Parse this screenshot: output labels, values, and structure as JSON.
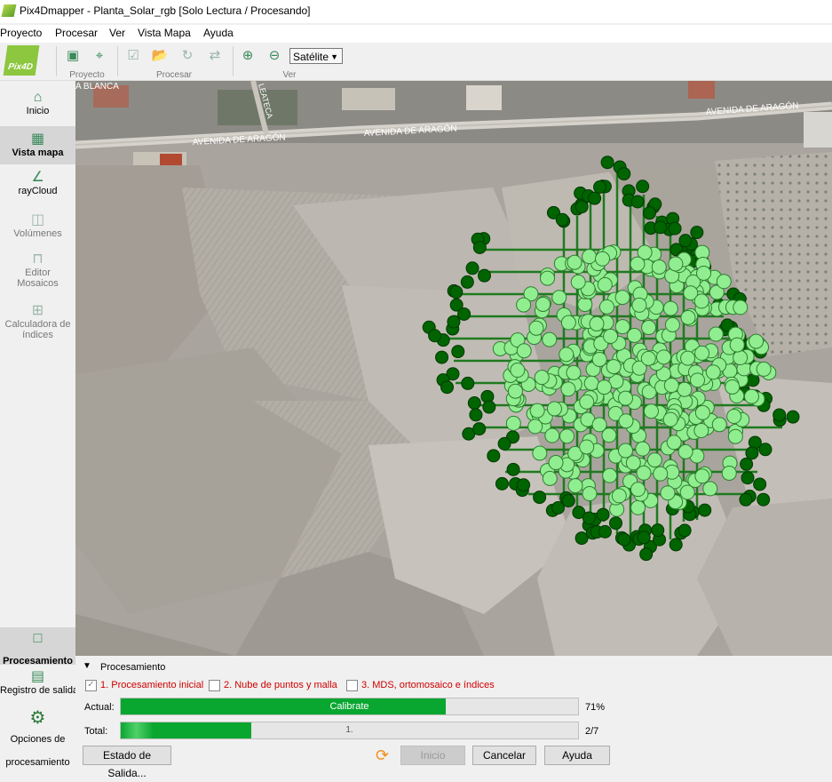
{
  "window": {
    "title": "Pix4Dmapper - Planta_Solar_rgb [Solo Lectura / Procesando]"
  },
  "menu": [
    "Proyecto",
    "Procesar",
    "Ver",
    "Vista Mapa",
    "Ayuda"
  ],
  "toolbar": {
    "logo_text": "Pix4D",
    "groups": {
      "project": "Proyecto",
      "process": "Procesar",
      "view": "Ver"
    },
    "basemap_select": "Satélite"
  },
  "sidebar": {
    "items": [
      {
        "label": "Inicio",
        "icon": "home-icon"
      },
      {
        "label": "Vista mapa",
        "icon": "map-icon"
      },
      {
        "label": "rayCloud",
        "icon": "raycloud-icon"
      },
      {
        "label": "Volúmenes",
        "icon": "volumes-icon"
      },
      {
        "label": "Editor Mosaicos",
        "icon": "mosaic-editor-icon"
      },
      {
        "label": "Calculadora de índices",
        "icon": "index-calculator-icon"
      }
    ],
    "bottom": [
      {
        "label": "Procesamiento",
        "icon": "processing-icon"
      },
      {
        "label": "Registro de salida",
        "icon": "log-icon"
      },
      {
        "label": "Opciones de procesamiento",
        "icon": "gear-icon"
      }
    ]
  },
  "map": {
    "streets": [
      "AVENIDA DE ARAGÓN",
      "AVENIDA DE ARAGÓN",
      "AVENIDA DE ARAGÓN",
      "A BLANCA",
      "LEATECA"
    ],
    "flight_path_color": "#1f7a1f",
    "image_point_color": "#90ee90",
    "marker_color": "#006400"
  },
  "processing": {
    "header": "Procesamiento",
    "steps": [
      {
        "label": "1. Procesamiento inicial",
        "checked": true
      },
      {
        "label": "2. Nube de puntos y malla",
        "checked": false
      },
      {
        "label": "3. MDS, ortomosaico e índices",
        "checked": false
      }
    ],
    "current": {
      "label": "Actual:",
      "task": "Calibrate",
      "percent": 71,
      "percent_text": "71%"
    },
    "total": {
      "label": "Total:",
      "task": "1.",
      "fraction": 0.2857,
      "count_text": "2/7"
    },
    "buttons": {
      "output_status": "Estado de Salida...",
      "start": "Inicio",
      "cancel": "Cancelar",
      "help": "Ayuda"
    }
  }
}
